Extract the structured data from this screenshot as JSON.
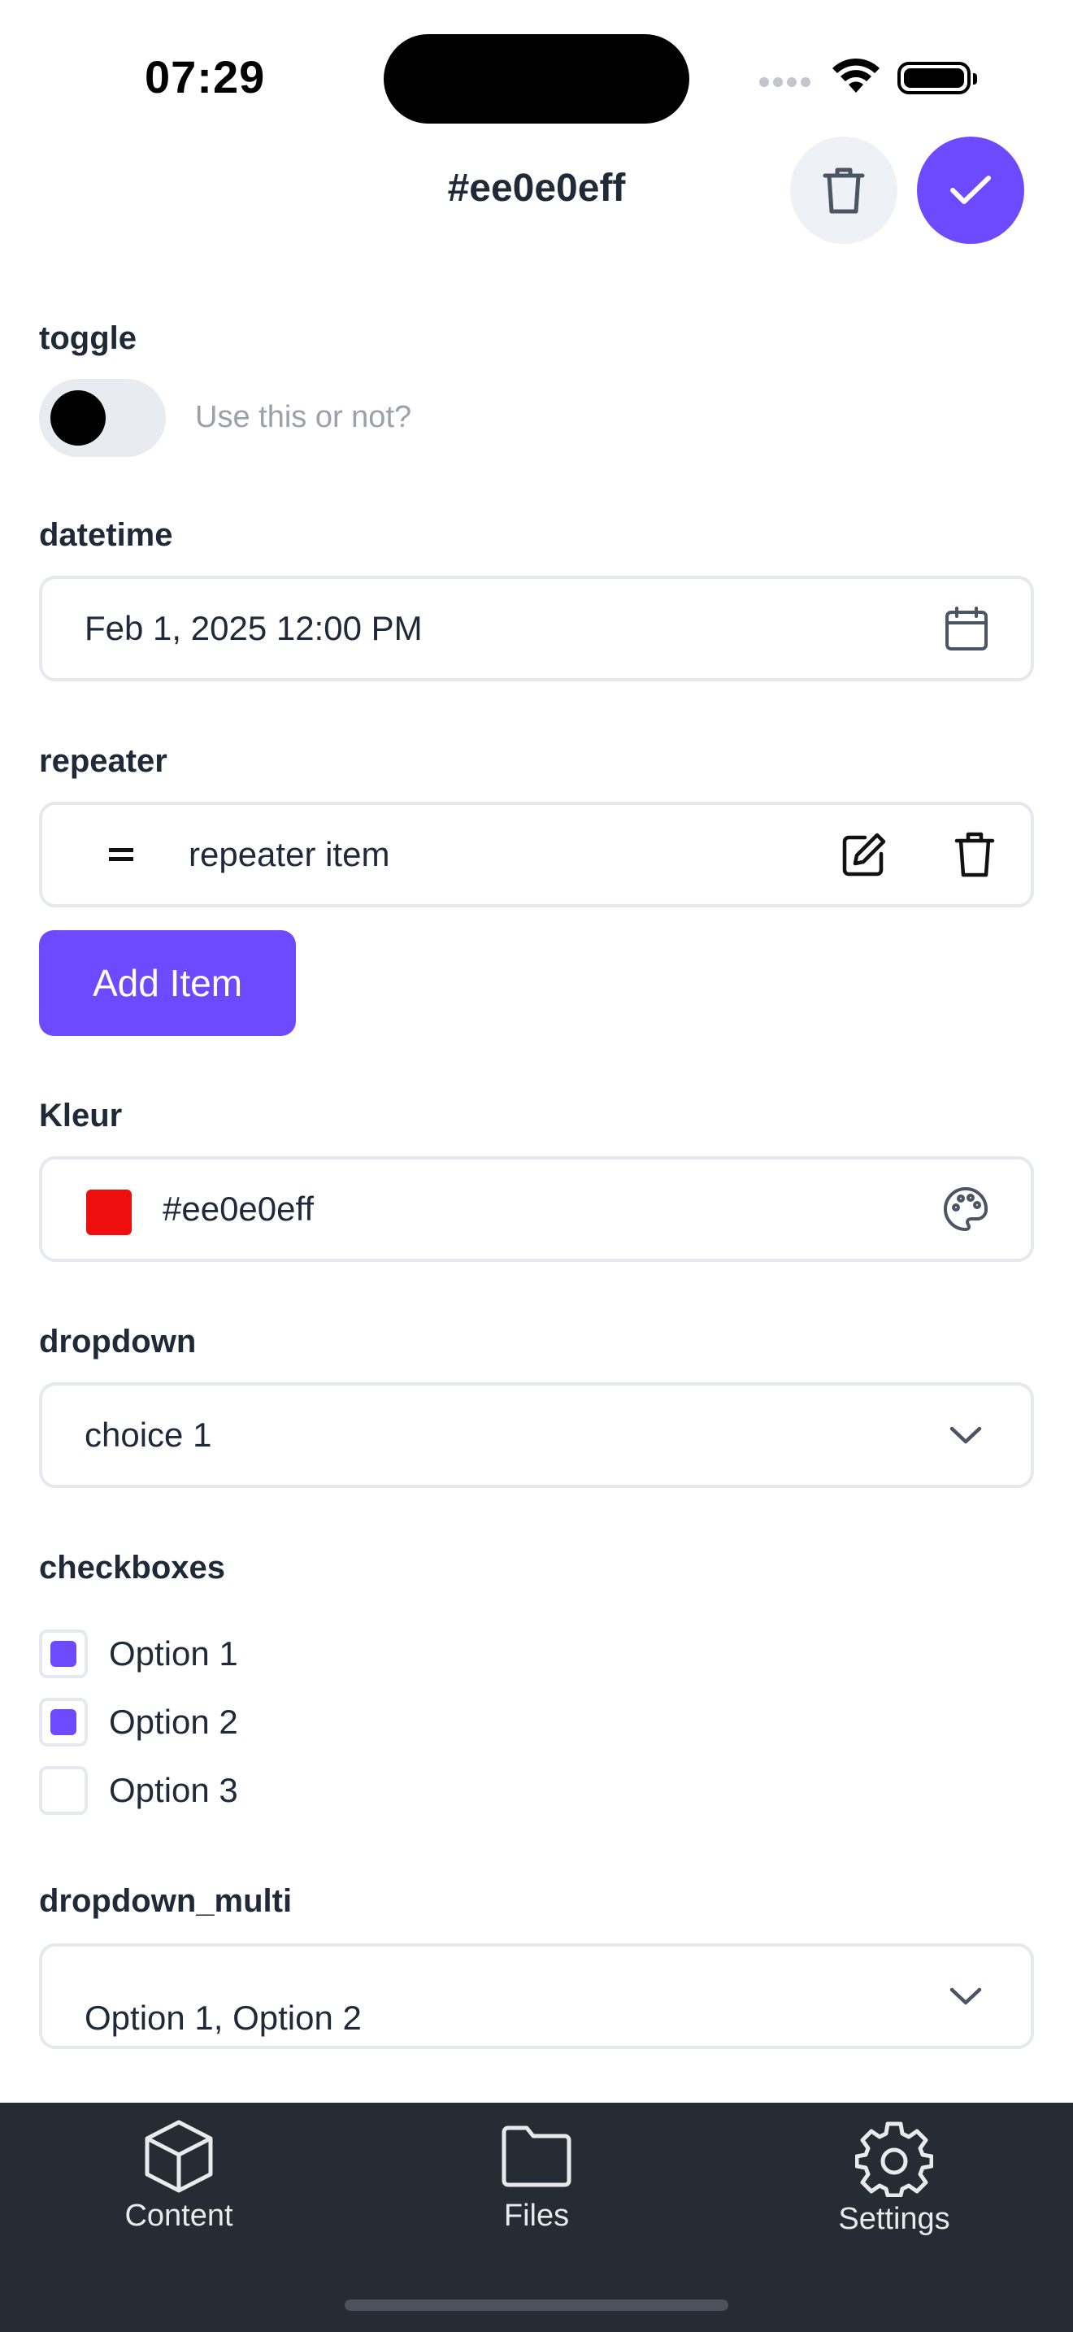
{
  "status_bar": {
    "time": "07:29"
  },
  "header": {
    "title": "#ee0e0eff",
    "delete_icon": "trash-icon",
    "save_icon": "check-icon"
  },
  "fields": {
    "toggle": {
      "label": "toggle",
      "hint": "Use this or not?",
      "on": false
    },
    "datetime": {
      "label": "datetime",
      "value": "Feb 1, 2025 12:00 PM",
      "icon": "calendar-icon"
    },
    "repeater": {
      "label": "repeater",
      "item": "repeater item",
      "add_label": "Add Item"
    },
    "kleur": {
      "label": "Kleur",
      "value": "#ee0e0eff",
      "swatch_color": "#ee0e0e",
      "icon": "palette-icon"
    },
    "dropdown": {
      "label": "dropdown",
      "value": "choice 1"
    },
    "checkboxes": {
      "label": "checkboxes",
      "options": [
        {
          "label": "Option 1",
          "checked": true
        },
        {
          "label": "Option 2",
          "checked": true
        },
        {
          "label": "Option 3",
          "checked": false
        }
      ]
    },
    "dropdown_multi": {
      "label": "dropdown_multi",
      "value": "Option 1, Option 2"
    }
  },
  "tabbar": {
    "items": [
      {
        "label": "Content",
        "icon": "cube-icon"
      },
      {
        "label": "Files",
        "icon": "folder-icon"
      },
      {
        "label": "Settings",
        "icon": "gear-icon"
      }
    ]
  },
  "colors": {
    "accent": "#6d4aff",
    "tabbar_bg": "#262c34",
    "border": "#e5e9ef"
  }
}
